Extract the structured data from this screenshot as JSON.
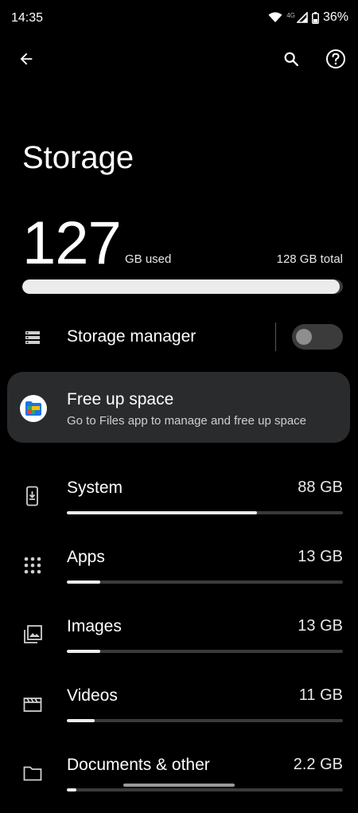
{
  "status_bar": {
    "time": "14:35",
    "network": "4G",
    "battery": "36%",
    "icons": [
      "wifi-icon",
      "signal-icon",
      "battery-icon"
    ]
  },
  "top_bar": {
    "icons": [
      "back-arrow-icon",
      "search-icon",
      "help-icon"
    ]
  },
  "page": {
    "title": "Storage"
  },
  "summary": {
    "used_value": "127",
    "used_unit": "GB used",
    "total_text": "128 GB total",
    "usage_fraction": 0.99
  },
  "storage_manager": {
    "label": "Storage manager",
    "enabled": false,
    "icon": "storage-list-icon"
  },
  "free_up_space": {
    "title": "Free up space",
    "subtitle": "Go to Files app to manage and free up space",
    "icon": "files-app-icon"
  },
  "categories": [
    {
      "name": "System",
      "size": "88 GB",
      "fraction": 0.69,
      "icon": "system-phone-icon"
    },
    {
      "name": "Apps",
      "size": "13 GB",
      "fraction": 0.12,
      "icon": "apps-grid-icon"
    },
    {
      "name": "Images",
      "size": "13 GB",
      "fraction": 0.12,
      "icon": "images-icon"
    },
    {
      "name": "Videos",
      "size": "11 GB",
      "fraction": 0.1,
      "icon": "videos-clapper-icon"
    },
    {
      "name": "Documents & other",
      "size": "2.2 GB",
      "fraction": 0.035,
      "icon": "folder-icon"
    }
  ],
  "colors": {
    "background": "#000000",
    "card": "#2a2b2d",
    "bar_fill": "#ececec",
    "bar_track": "#3a3a3a"
  }
}
